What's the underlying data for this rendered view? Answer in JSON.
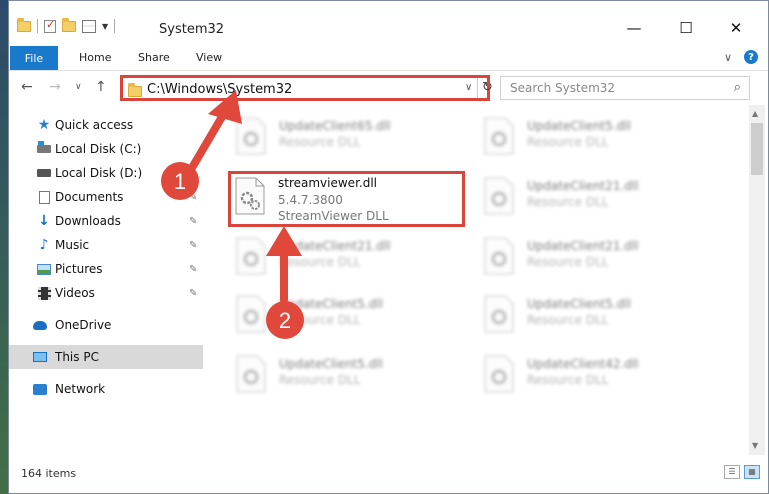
{
  "window": {
    "title": "System32",
    "minimize": "—",
    "maximize": "☐",
    "close": "✕"
  },
  "ribbon": {
    "tabs": [
      "File",
      "Home",
      "Share",
      "View"
    ],
    "expand": "∨",
    "help": "?"
  },
  "nav": {
    "back": "←",
    "forward": "→",
    "recent": "∨",
    "up": "↑",
    "address": "C:\\Windows\\System32",
    "address_dropdown": "∨",
    "refresh": "↻",
    "search_placeholder": "Search System32",
    "search_icon": "⌕"
  },
  "sidebar": {
    "items": [
      {
        "label": "Quick access",
        "icon": "star-icon",
        "pinned": false
      },
      {
        "label": "Local Disk (C:)",
        "icon": "drive-c-icon",
        "pinned": false
      },
      {
        "label": "Local Disk (D:)",
        "icon": "drive-d-icon",
        "pinned": false
      },
      {
        "label": "Documents",
        "icon": "documents-icon",
        "pinned": true
      },
      {
        "label": "Downloads",
        "icon": "downloads-icon",
        "pinned": true
      },
      {
        "label": "Music",
        "icon": "music-icon",
        "pinned": true
      },
      {
        "label": "Pictures",
        "icon": "pictures-icon",
        "pinned": true
      },
      {
        "label": "Videos",
        "icon": "videos-icon",
        "pinned": true
      },
      {
        "label": "OneDrive",
        "icon": "onedrive-icon",
        "pinned": false
      },
      {
        "label": "This PC",
        "icon": "this-pc-icon",
        "pinned": false,
        "selected": true
      },
      {
        "label": "Network",
        "icon": "network-icon",
        "pinned": false
      }
    ],
    "pin_glyph": "📌"
  },
  "files": [
    {
      "name": "UpdateClient65.dll",
      "type": "Resource DLL",
      "blurred": true
    },
    {
      "name": "UpdateClient5.dll",
      "type": "Resource DLL",
      "blurred": true
    },
    {
      "name": "streamviewer.dll",
      "version": "5.4.7.3800",
      "type": "StreamViewer DLL",
      "blurred": false
    },
    {
      "name": "UpdateClient21.dll",
      "type": "Resource DLL",
      "blurred": true
    },
    {
      "name": "UpdateClient21.dll",
      "type": "Resource DLL",
      "blurred": true
    },
    {
      "name": "UpdateClient21.dll",
      "type": "Resource DLL",
      "blurred": true
    },
    {
      "name": "UpdateClient5.dll",
      "type": "Resource DLL",
      "blurred": true
    },
    {
      "name": "UpdateClient5.dll",
      "type": "Resource DLL",
      "blurred": true
    },
    {
      "name": "UpdateClient5.dll",
      "type": "Resource DLL",
      "blurred": true
    },
    {
      "name": "UpdateClient42.dll",
      "type": "Resource DLL",
      "blurred": true
    }
  ],
  "status": {
    "item_count": "164 items"
  },
  "annotations": {
    "step1": "1",
    "step2": "2",
    "color": "#e0483c"
  }
}
